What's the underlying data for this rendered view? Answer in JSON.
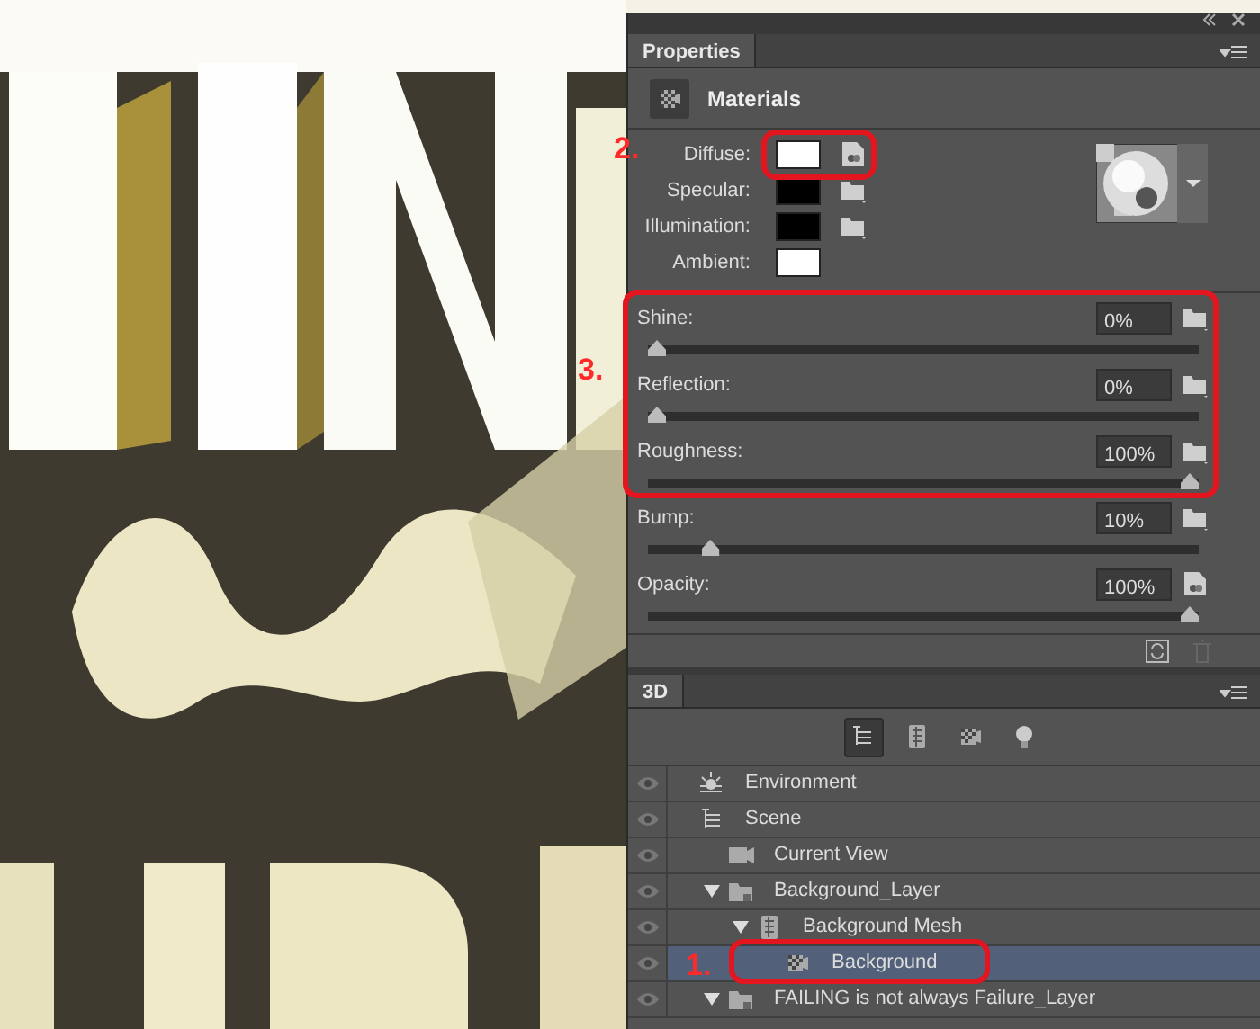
{
  "properties_panel": {
    "tab": "Properties",
    "section": "Materials",
    "textures": [
      {
        "label": "Diffuse:",
        "color": "#ffffff",
        "kind": "texture"
      },
      {
        "label": "Specular:",
        "color": "#000000",
        "kind": "folder"
      },
      {
        "label": "Illumination:",
        "color": "#000000",
        "kind": "folder"
      },
      {
        "label": "Ambient:",
        "color": "#ffffff",
        "kind": "none"
      }
    ],
    "sliders": [
      {
        "label": "Shine:",
        "value": "0%",
        "level": 0,
        "kind": "folder"
      },
      {
        "label": "Reflection:",
        "value": "0%",
        "level": 0,
        "kind": "folder"
      },
      {
        "label": "Roughness:",
        "value": "100%",
        "level": 1,
        "kind": "folder"
      },
      {
        "label": "Bump:",
        "value": "10%",
        "level": 0.1,
        "kind": "folder"
      },
      {
        "label": "Opacity:",
        "value": "100%",
        "level": 1,
        "kind": "texture"
      }
    ]
  },
  "panel_3d": {
    "tab": "3D",
    "filters": [
      {
        "kind": "scene",
        "selected": true
      },
      {
        "kind": "mesh",
        "selected": false
      },
      {
        "kind": "material",
        "selected": false
      },
      {
        "kind": "light",
        "selected": false
      }
    ],
    "tree": [
      {
        "label": "Environment",
        "kind": "environment",
        "selected": false
      },
      {
        "label": "Scene",
        "kind": "scene",
        "selected": false,
        "children": [
          {
            "label": "Current View",
            "kind": "camera",
            "selected": false
          },
          {
            "label": "Background_Layer",
            "kind": "layer",
            "selected": false,
            "expanded": true,
            "children": [
              {
                "label": "Background Mesh",
                "kind": "mesh",
                "selected": false,
                "expanded": true,
                "children": [
                  {
                    "label": "Background",
                    "kind": "material",
                    "selected": true
                  }
                ]
              }
            ]
          },
          {
            "label": "FAILING is not always Failure_Layer",
            "kind": "layer",
            "selected": false,
            "expanded": true
          }
        ]
      }
    ]
  },
  "annotations": [
    {
      "label": "2."
    },
    {
      "label": "3."
    },
    {
      "label": "1."
    }
  ]
}
